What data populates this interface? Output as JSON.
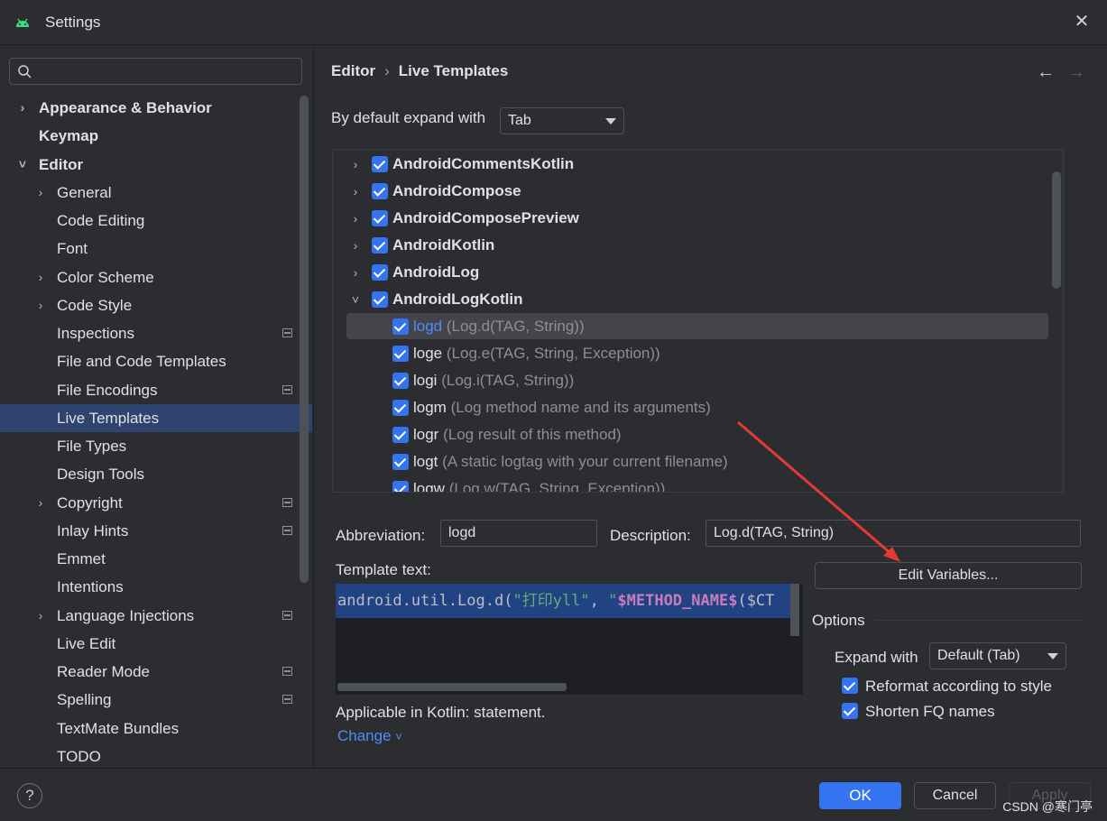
{
  "window": {
    "title": "Settings",
    "close_glyph": "✕"
  },
  "sidebar": {
    "search_placeholder": "",
    "items": [
      {
        "label": "Appearance & Behavior",
        "level": 0,
        "bold": true,
        "arrow": "›"
      },
      {
        "label": "Keymap",
        "level": 0,
        "bold": true,
        "arrow": ""
      },
      {
        "label": "Editor",
        "level": 0,
        "bold": true,
        "arrow": "˅"
      },
      {
        "label": "General",
        "level": 1,
        "bold": false,
        "arrow": "›"
      },
      {
        "label": "Code Editing",
        "level": 1,
        "bold": false,
        "arrow": ""
      },
      {
        "label": "Font",
        "level": 1,
        "bold": false,
        "arrow": ""
      },
      {
        "label": "Color Scheme",
        "level": 1,
        "bold": false,
        "arrow": "›"
      },
      {
        "label": "Code Style",
        "level": 1,
        "bold": false,
        "arrow": "›"
      },
      {
        "label": "Inspections",
        "level": 1,
        "bold": false,
        "arrow": "",
        "project": true
      },
      {
        "label": "File and Code Templates",
        "level": 1,
        "bold": false,
        "arrow": ""
      },
      {
        "label": "File Encodings",
        "level": 1,
        "bold": false,
        "arrow": "",
        "project": true
      },
      {
        "label": "Live Templates",
        "level": 1,
        "bold": false,
        "arrow": "",
        "selected": true
      },
      {
        "label": "File Types",
        "level": 1,
        "bold": false,
        "arrow": ""
      },
      {
        "label": "Design Tools",
        "level": 1,
        "bold": false,
        "arrow": ""
      },
      {
        "label": "Copyright",
        "level": 1,
        "bold": false,
        "arrow": "›",
        "project": true
      },
      {
        "label": "Inlay Hints",
        "level": 1,
        "bold": false,
        "arrow": "",
        "project": true
      },
      {
        "label": "Emmet",
        "level": 1,
        "bold": false,
        "arrow": ""
      },
      {
        "label": "Intentions",
        "level": 1,
        "bold": false,
        "arrow": ""
      },
      {
        "label": "Language Injections",
        "level": 1,
        "bold": false,
        "arrow": "›",
        "project": true
      },
      {
        "label": "Live Edit",
        "level": 1,
        "bold": false,
        "arrow": ""
      },
      {
        "label": "Reader Mode",
        "level": 1,
        "bold": false,
        "arrow": "",
        "project": true
      },
      {
        "label": "Spelling",
        "level": 1,
        "bold": false,
        "arrow": "",
        "project": true
      },
      {
        "label": "TextMate Bundles",
        "level": 1,
        "bold": false,
        "arrow": ""
      },
      {
        "label": "TODO",
        "level": 1,
        "bold": false,
        "arrow": ""
      }
    ]
  },
  "breadcrumb": {
    "parent": "Editor",
    "separator": "›",
    "current": "Live Templates",
    "back_glyph": "←",
    "forward_glyph": "→"
  },
  "expand_default": {
    "label": "By default expand with",
    "value": "Tab"
  },
  "templates": {
    "groups": [
      {
        "name": "AndroidCommentsKotlin",
        "expanded": false,
        "checked": true
      },
      {
        "name": "AndroidCompose",
        "expanded": false,
        "checked": true
      },
      {
        "name": "AndroidComposePreview",
        "expanded": false,
        "checked": true
      },
      {
        "name": "AndroidKotlin",
        "expanded": false,
        "checked": true
      },
      {
        "name": "AndroidLog",
        "expanded": false,
        "checked": true
      },
      {
        "name": "AndroidLogKotlin",
        "expanded": true,
        "checked": true
      }
    ],
    "items": [
      {
        "abbr": "logd",
        "desc": "(Log.d(TAG, String))",
        "checked": true,
        "selected": true
      },
      {
        "abbr": "loge",
        "desc": "(Log.e(TAG, String, Exception))",
        "checked": true
      },
      {
        "abbr": "logi",
        "desc": "(Log.i(TAG, String))",
        "checked": true
      },
      {
        "abbr": "logm",
        "desc": "(Log method name and its arguments)",
        "checked": true
      },
      {
        "abbr": "logr",
        "desc": "(Log result of this method)",
        "checked": true
      },
      {
        "abbr": "logt",
        "desc": "(A static logtag with your current filename)",
        "checked": true
      },
      {
        "abbr": "logw",
        "desc": "(Log.w(TAG, String, Exception))",
        "checked": true
      }
    ],
    "toolbar": {
      "add_glyph": "+",
      "remove_glyph": "—",
      "copy_glyph": "⎘",
      "restore_glyph": "↶"
    },
    "expanded_arrow": "˅",
    "collapsed_arrow": "›"
  },
  "details": {
    "abbreviation_label": "Abbreviation:",
    "abbreviation_value": "logd",
    "description_label": "Description:",
    "description_value": "Log.d(TAG, String)",
    "template_text_label": "Template text:",
    "template_code_part1": "android.util.Log.d(",
    "template_code_str": "\"打印yll\"",
    "template_code_part2": ", ",
    "template_code_str2": "\"",
    "template_code_var": "$METHOD_NAME$",
    "template_code_part3": "($CT",
    "edit_variables_label": "Edit Variables...",
    "options_label": "Options",
    "expand_with_label": "Expand with",
    "expand_with_value": "Default (Tab)",
    "reformat_label": "Reformat according to style",
    "reformat_checked": true,
    "shorten_label": "Shorten FQ names",
    "shorten_checked": true,
    "applicable_text": "Applicable in Kotlin: statement.",
    "change_label": "Change",
    "change_glyph": "˅"
  },
  "footer": {
    "help_glyph": "?",
    "ok_label": "OK",
    "cancel_label": "Cancel",
    "apply_label": "Apply",
    "watermark": "CSDN @寒门亭"
  },
  "colors": {
    "background": "#2b2d30",
    "accent": "#3574f0",
    "selection": "#2e436e",
    "annotation_arrow": "#e53935"
  }
}
